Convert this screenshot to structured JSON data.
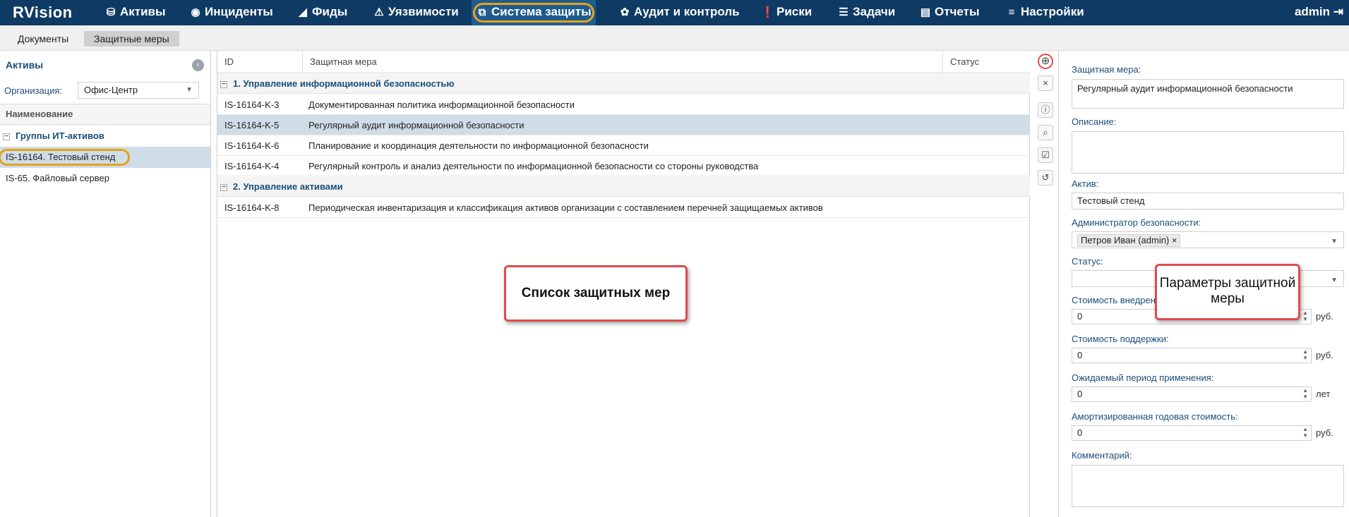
{
  "app": {
    "logo": "RVision",
    "user": "admin"
  },
  "nav": [
    {
      "label": "Активы",
      "icon": "⛁"
    },
    {
      "label": "Инциденты",
      "icon": "◉"
    },
    {
      "label": "Фиды",
      "icon": "◢"
    },
    {
      "label": "Уязвимости",
      "icon": "⚠"
    },
    {
      "label": "Система защиты",
      "icon": "⧉"
    },
    {
      "label": "Аудит и контроль",
      "icon": "✿"
    },
    {
      "label": "Риски",
      "icon": "❗"
    },
    {
      "label": "Задачи",
      "icon": "☰"
    },
    {
      "label": "Отчеты",
      "icon": "▤"
    },
    {
      "label": "Настройки",
      "icon": "≡"
    }
  ],
  "subtabs": [
    {
      "label": "Документы"
    },
    {
      "label": "Защитные меры"
    }
  ],
  "left": {
    "title": "Активы",
    "collapse_icon": "‹",
    "org_label": "Организация:",
    "org_value": "Офис-Центр",
    "column": "Наименование",
    "group": "Группы ИТ-активов",
    "assets": [
      {
        "label": "IS-16164. Тестовый стенд"
      },
      {
        "label": "IS-65. Файловый сервер"
      }
    ]
  },
  "table": {
    "headers": {
      "id": "ID",
      "name": "Защитная мера",
      "status": "Статус"
    },
    "sections": [
      {
        "title": "1. Управление информационной безопасностью"
      },
      {
        "title": "2. Управление активами"
      }
    ],
    "rows": [
      {
        "id": "IS-16164-K-3",
        "name": "Документированная политика информационной безопасности"
      },
      {
        "id": "IS-16164-K-5",
        "name": "Регулярный аудит информационной безопасности"
      },
      {
        "id": "IS-16164-K-6",
        "name": "Планирование и координация деятельности по информационной безопасности"
      },
      {
        "id": "IS-16164-K-4",
        "name": "Регулярный контроль и анализ деятельности по информационной безопасности со стороны руководства"
      },
      {
        "id": "IS-16164-K-8",
        "name": "Периодическая инвентаризация и классификация активов организации с составлением перечней защищаемых активов"
      }
    ]
  },
  "callouts": {
    "list": "Список защитных мер",
    "params": "Параметры защитной меры"
  },
  "tools": {
    "add": "⊕",
    "delete": "×",
    "info": "ⓘ",
    "attach": "⌕",
    "check": "☑",
    "history": "↺"
  },
  "form": {
    "measure_label": "Защитная мера:",
    "measure_value": "Регулярный аудит информационной безопасности",
    "description_label": "Описание:",
    "asset_label": "Актив:",
    "asset_value": "Тестовый стенд",
    "admin_label": "Администратор безопасности:",
    "admin_value": "Петров Иван (admin)",
    "admin_remove": "×",
    "status_label": "Статус:",
    "impl_cost_label": "Стоимость внедрен",
    "impl_cost_value": "0",
    "impl_cost_unit": "руб.",
    "support_cost_label": "Стоимость поддержки:",
    "support_cost_value": "0",
    "support_cost_unit": "руб.",
    "period_label": "Ожидаемый период применения:",
    "period_value": "0",
    "period_unit": "лет",
    "amort_label": "Амортизированная годовая стоимость:",
    "amort_value": "0",
    "amort_unit": "руб.",
    "comment_label": "Комментарий:"
  }
}
